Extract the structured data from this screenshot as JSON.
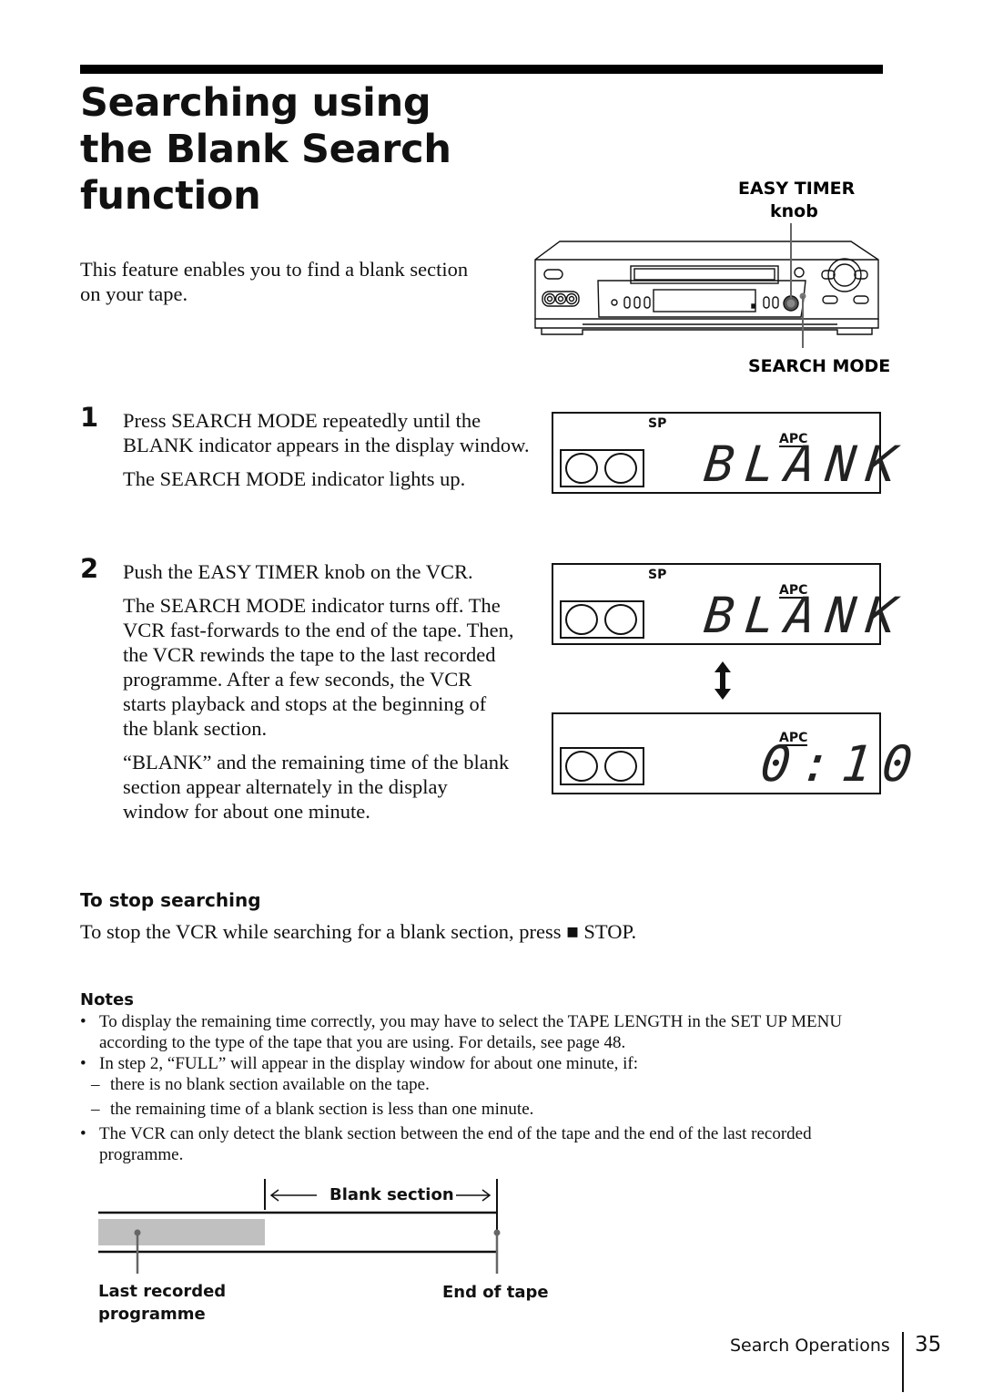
{
  "page": {
    "title_lines": [
      "Searching using",
      "the Blank Search",
      "function"
    ],
    "intro": "This feature enables you to find a blank section on your tape."
  },
  "vcr_figure": {
    "label_top_line1": "EASY TIMER",
    "label_top_line2": "knob",
    "label_bottom": "SEARCH MODE",
    "eject_glyph": "⏏"
  },
  "steps": [
    {
      "number": "1",
      "paragraphs": [
        "Press SEARCH MODE repeatedly until the BLANK indicator appears in the display window.",
        "The SEARCH MODE indicator lights up."
      ]
    },
    {
      "number": "2",
      "paragraphs": [
        "Push the EASY TIMER knob on the VCR.",
        "The SEARCH MODE indicator turns off. The VCR fast-forwards to the end of the tape. Then, the VCR rewinds the tape to the last recorded programme. After a few seconds, the VCR starts playback and stops at the beginning of the blank section.",
        "“BLANK” and the remaining time of the blank section appear alternately in the display window for about one minute."
      ]
    }
  ],
  "displays": [
    {
      "mode_indicator": "SP",
      "apc": "APC",
      "readout": "BLANK"
    },
    {
      "mode_indicator": "SP",
      "apc": "APC",
      "readout": "BLANK"
    },
    {
      "mode_indicator": "",
      "apc": "APC",
      "readout": "0:10"
    }
  ],
  "alternate_arrow_glyph": "↕",
  "stop_section": {
    "heading": "To stop searching",
    "text_before": "To stop the VCR while searching for a blank section, press ",
    "stop_glyph": "■",
    "text_after": " STOP."
  },
  "notes": {
    "heading": "Notes",
    "bullet_glyph": "•",
    "dash_glyph": "–",
    "items": [
      {
        "text": "To display the remaining time correctly, you may have to select the TAPE LENGTH in the SET UP MENU according to the type of the tape that you are using. For details, see page 48.",
        "subs": []
      },
      {
        "text": "In step 2, “FULL” will appear in the display window for about one minute, if:",
        "subs": [
          "there is no blank section available on the tape.",
          "the remaining time of a blank section is less than one minute."
        ]
      },
      {
        "text": "The VCR can only detect the blank section between the end of the tape and the end of the last recorded programme.",
        "subs": []
      }
    ]
  },
  "tape_diagram": {
    "blank_section_label": "Blank section",
    "last_recorded_label_line1": "Last recorded",
    "last_recorded_label_line2": "programme",
    "end_of_tape_label": "End of tape",
    "recorded_fill_color": "#c0c0c0"
  },
  "footer": {
    "section": "Search Operations",
    "page_number": "35"
  }
}
